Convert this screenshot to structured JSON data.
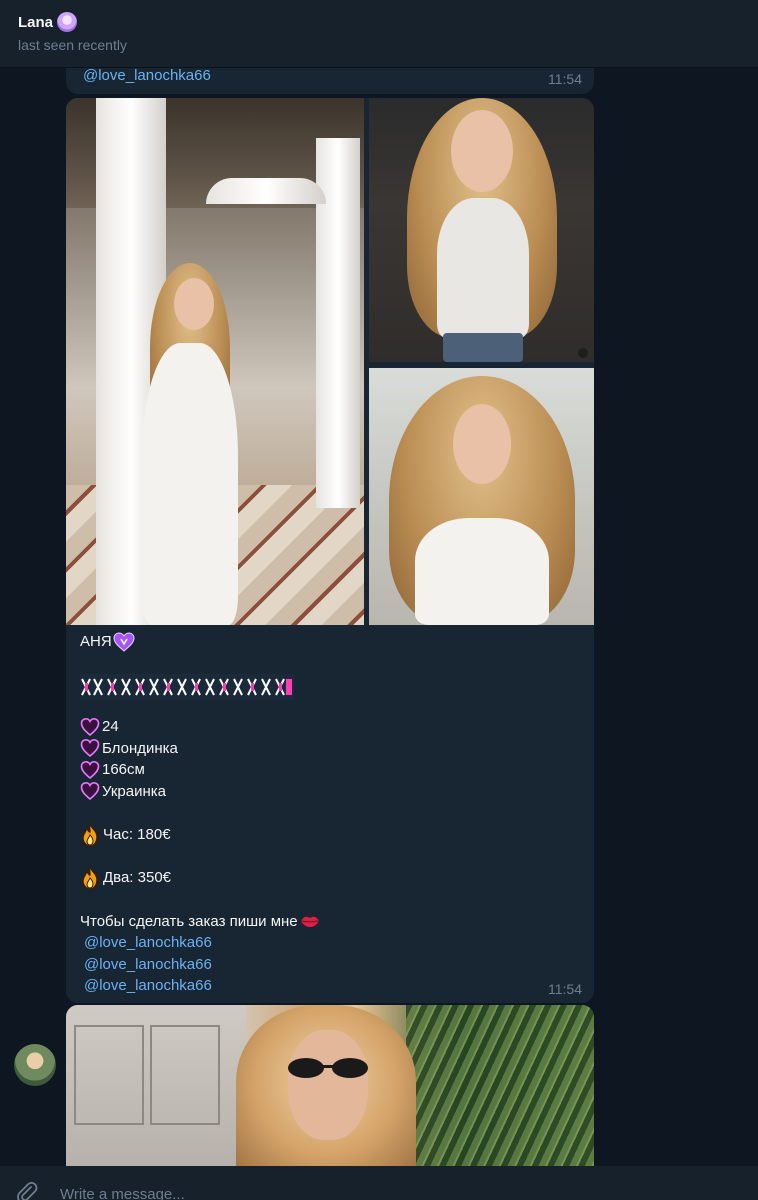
{
  "header": {
    "chat_name": "Lana",
    "chat_name_icon": "flower-icon",
    "status": "last seen recently"
  },
  "previous_message": {
    "mention": "@love_lanochka66",
    "time": "11:54"
  },
  "main_message": {
    "photos": [
      {
        "name": "photo-woman-white-dress-arches"
      },
      {
        "name": "photo-woman-white-top-dark-background"
      },
      {
        "name": "photo-woman-white-blouse-light-background"
      }
    ],
    "title": "АНЯ",
    "title_icon": "purple-heart-icon",
    "decorative_text_icon": "pink-patterned-banner",
    "details": [
      {
        "icon": "heart-outline-icon",
        "text": "24"
      },
      {
        "icon": "heart-outline-icon",
        "text": "Блондинка"
      },
      {
        "icon": "heart-outline-icon",
        "text": "166см"
      },
      {
        "icon": "heart-outline-icon",
        "text": "Украинка"
      }
    ],
    "prices": [
      {
        "icon": "fire-icon",
        "text": "Час: 180€"
      },
      {
        "icon": "fire-icon",
        "text": "Два: 350€"
      }
    ],
    "order_text": "Чтобы сделать заказ пиши мне",
    "order_icon": "lips-icon",
    "mentions": [
      "@love_lanochka66",
      "@love_lanochka66",
      "@love_lanochka66"
    ],
    "time": "11:54"
  },
  "next_message": {
    "photo": "photo-woman-sunglasses-palm-trees"
  },
  "composer": {
    "placeholder": "Write a message...",
    "attach_icon": "paperclip-icon"
  },
  "colors": {
    "background": "#0e1621",
    "header": "#17212b",
    "bubble": "#182533",
    "link": "#6ab2f2",
    "muted": "#6d7f8f"
  }
}
